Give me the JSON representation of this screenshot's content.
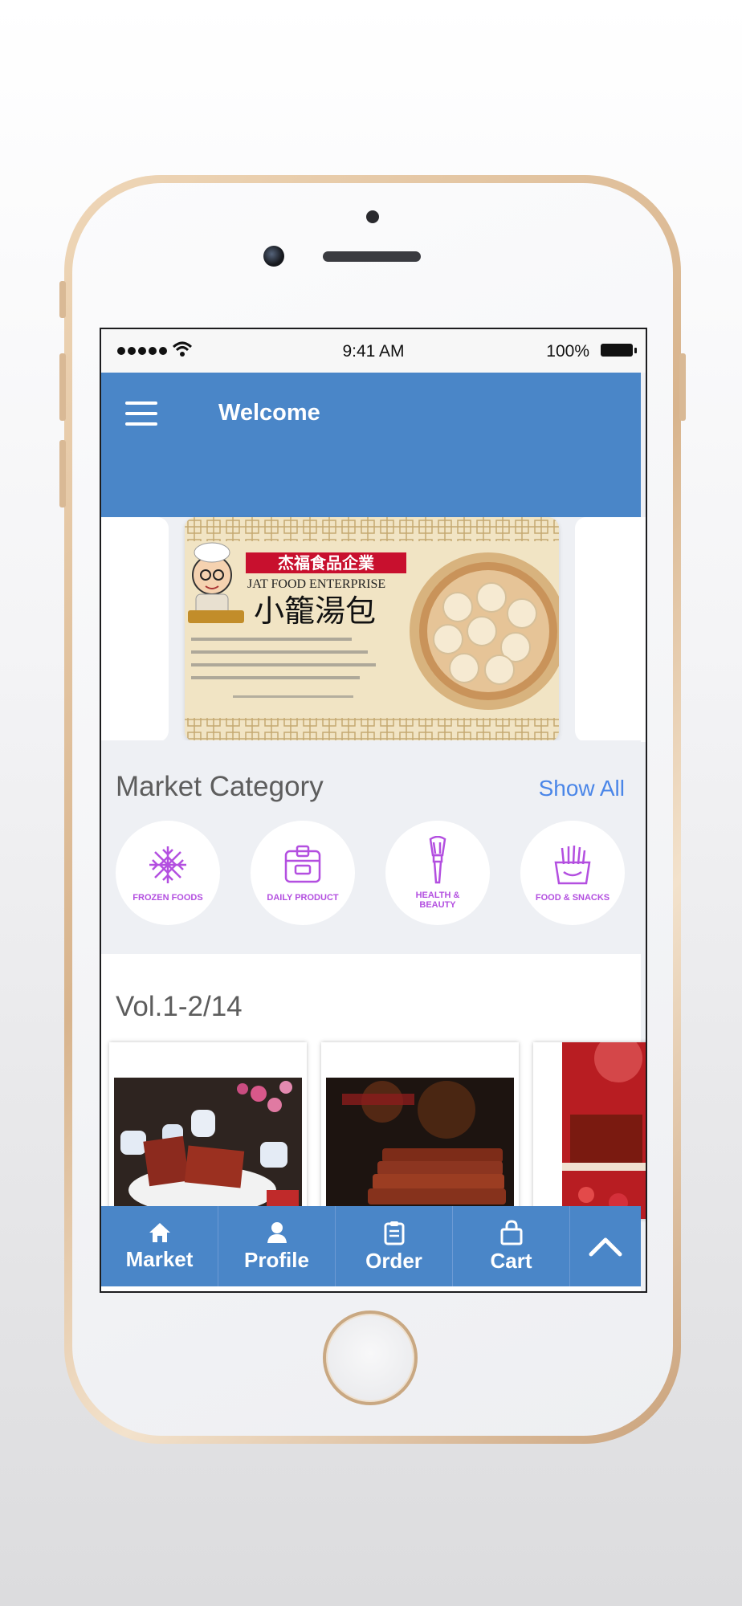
{
  "status_bar": {
    "time": "9:41 AM",
    "battery": "100%"
  },
  "header": {
    "title": "Welcome"
  },
  "banner": {
    "brand_chinese": "杰福食品企業",
    "brand_english": "JAT FOOD ENTERPRISE",
    "product_name": "小籠湯包"
  },
  "category": {
    "title": "Market Category",
    "show_all": "Show All",
    "items": [
      {
        "label": "FROZEN FOODS"
      },
      {
        "label": "DAILY PRODUCT"
      },
      {
        "label": "HEALTH & BEAUTY"
      },
      {
        "label": "FOOD & SNACKS"
      }
    ]
  },
  "volume": {
    "title": "Vol.1-2/14"
  },
  "tabs": [
    {
      "label": "Market",
      "icon": "home-icon"
    },
    {
      "label": "Profile",
      "icon": "user-icon"
    },
    {
      "label": "Order",
      "icon": "clipboard-icon"
    },
    {
      "label": "Cart",
      "icon": "bag-icon"
    }
  ],
  "colors": {
    "primary": "#4a86c8",
    "link": "#4a86e8",
    "category_icon": "#b34fe0"
  }
}
